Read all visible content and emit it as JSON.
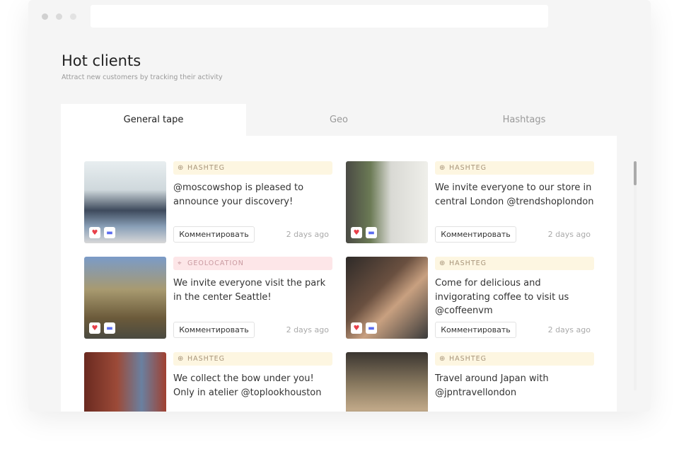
{
  "header": {
    "title": "Hot clients",
    "subtitle": "Attract new customers by tracking their activity"
  },
  "tabs": [
    {
      "label": "General tape",
      "active": true
    },
    {
      "label": "Geo"
    },
    {
      "label": "Hashtags"
    }
  ],
  "comment_label": "Комментировать",
  "cards": [
    {
      "tag": "HASHTEG",
      "type": "hashtag",
      "text": "@moscowshop is pleased to announce your discovery!",
      "time": "2 days ago"
    },
    {
      "tag": "HASHTEG",
      "type": "hashtag",
      "text": "We invite everyone to our store in central London @trendshoplondon",
      "time": "2 days ago"
    },
    {
      "tag": "GEOLOCATION",
      "type": "geo",
      "text": "We invite everyone visit the park in the center Seattle!",
      "time": "2 days ago"
    },
    {
      "tag": "HASHTEG",
      "type": "hashtag",
      "text": "Come for delicious and invigorating coffee to visit us @coffeenvm",
      "time": "2 days ago"
    },
    {
      "tag": "HASHTEG",
      "type": "hashtag",
      "text": "We collect the bow under you! Only in atelier @toplookhouston",
      "time": ""
    },
    {
      "tag": "HASHTEG",
      "type": "hashtag",
      "text": "Travel around Japan with @jpntravellondon",
      "time": ""
    }
  ],
  "colors": {
    "like": "#e8404a",
    "comment": "#5b6cf0",
    "hashtag_bg": "#fdf6e1",
    "geo_bg": "#fde6e8"
  }
}
